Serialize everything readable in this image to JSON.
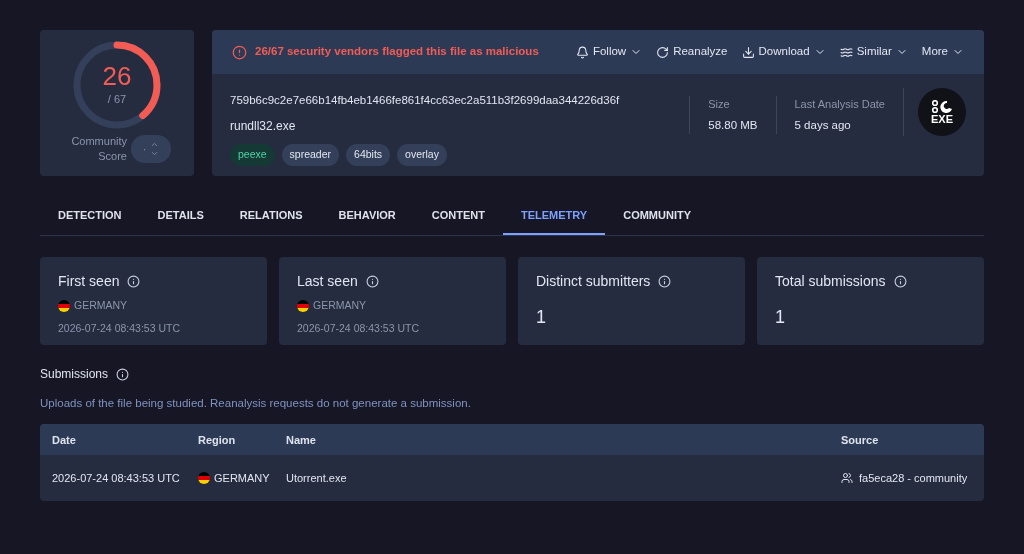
{
  "score": {
    "value": "26",
    "total": "/ 67",
    "level": 0.388,
    "community_label": "Community Score",
    "community_value": "·"
  },
  "alert": "26/67 security vendors flagged this file as malicious",
  "actions": [
    {
      "label": "Follow",
      "kind": "bell",
      "dropdown": true
    },
    {
      "label": "Reanalyze",
      "kind": "reload",
      "dropdown": false
    },
    {
      "label": "Download",
      "kind": "download",
      "dropdown": true
    },
    {
      "label": "Similar",
      "kind": "similar",
      "dropdown": true
    },
    {
      "label": "More",
      "kind": "none",
      "dropdown": true
    }
  ],
  "file": {
    "hash": "759b6c9c2e7e66b14fb4eb1466fe861f4cc63ec2a511b3f2699daa344226d36f",
    "name": "rundll32.exe",
    "tags": [
      {
        "label": "peexe",
        "kind": "type"
      },
      {
        "label": "spreader",
        "kind": "tag"
      },
      {
        "label": "64bits",
        "kind": "tag"
      },
      {
        "label": "overlay",
        "kind": "tag"
      }
    ],
    "size_label": "Size",
    "size": "58.80 MB",
    "date_label": "Last Analysis Date",
    "date": "5 days ago",
    "type_badge": "EXE"
  },
  "tabs": [
    {
      "label": "DETECTION",
      "selected": false
    },
    {
      "label": "DETAILS",
      "selected": false
    },
    {
      "label": "RELATIONS",
      "selected": false
    },
    {
      "label": "BEHAVIOR",
      "selected": false
    },
    {
      "label": "CONTENT",
      "selected": false
    },
    {
      "label": "TELEMETRY",
      "selected": true
    },
    {
      "label": "COMMUNITY",
      "selected": false
    }
  ],
  "stats": [
    {
      "title": "First seen",
      "kind": "seen",
      "country": "GERMANY",
      "time": "2026-07-24 08:43:53 UTC"
    },
    {
      "title": "Last seen",
      "kind": "seen",
      "country": "GERMANY",
      "time": "2026-07-24 08:43:53 UTC"
    },
    {
      "title": "Distinct submitters",
      "kind": "count",
      "value": "1"
    },
    {
      "title": "Total submissions",
      "kind": "count",
      "value": "1"
    }
  ],
  "submissions": {
    "title": "Submissions",
    "description": "Uploads of the file being studied. Reanalysis requests do not generate a submission.",
    "columns": [
      "Date",
      "Region",
      "Name",
      "Source"
    ],
    "rows": [
      {
        "date": "2026-07-24 08:43:53 UTC",
        "region": "GERMANY",
        "name": "Utorrent.exe",
        "source": "fa5eca28 - community"
      }
    ]
  }
}
